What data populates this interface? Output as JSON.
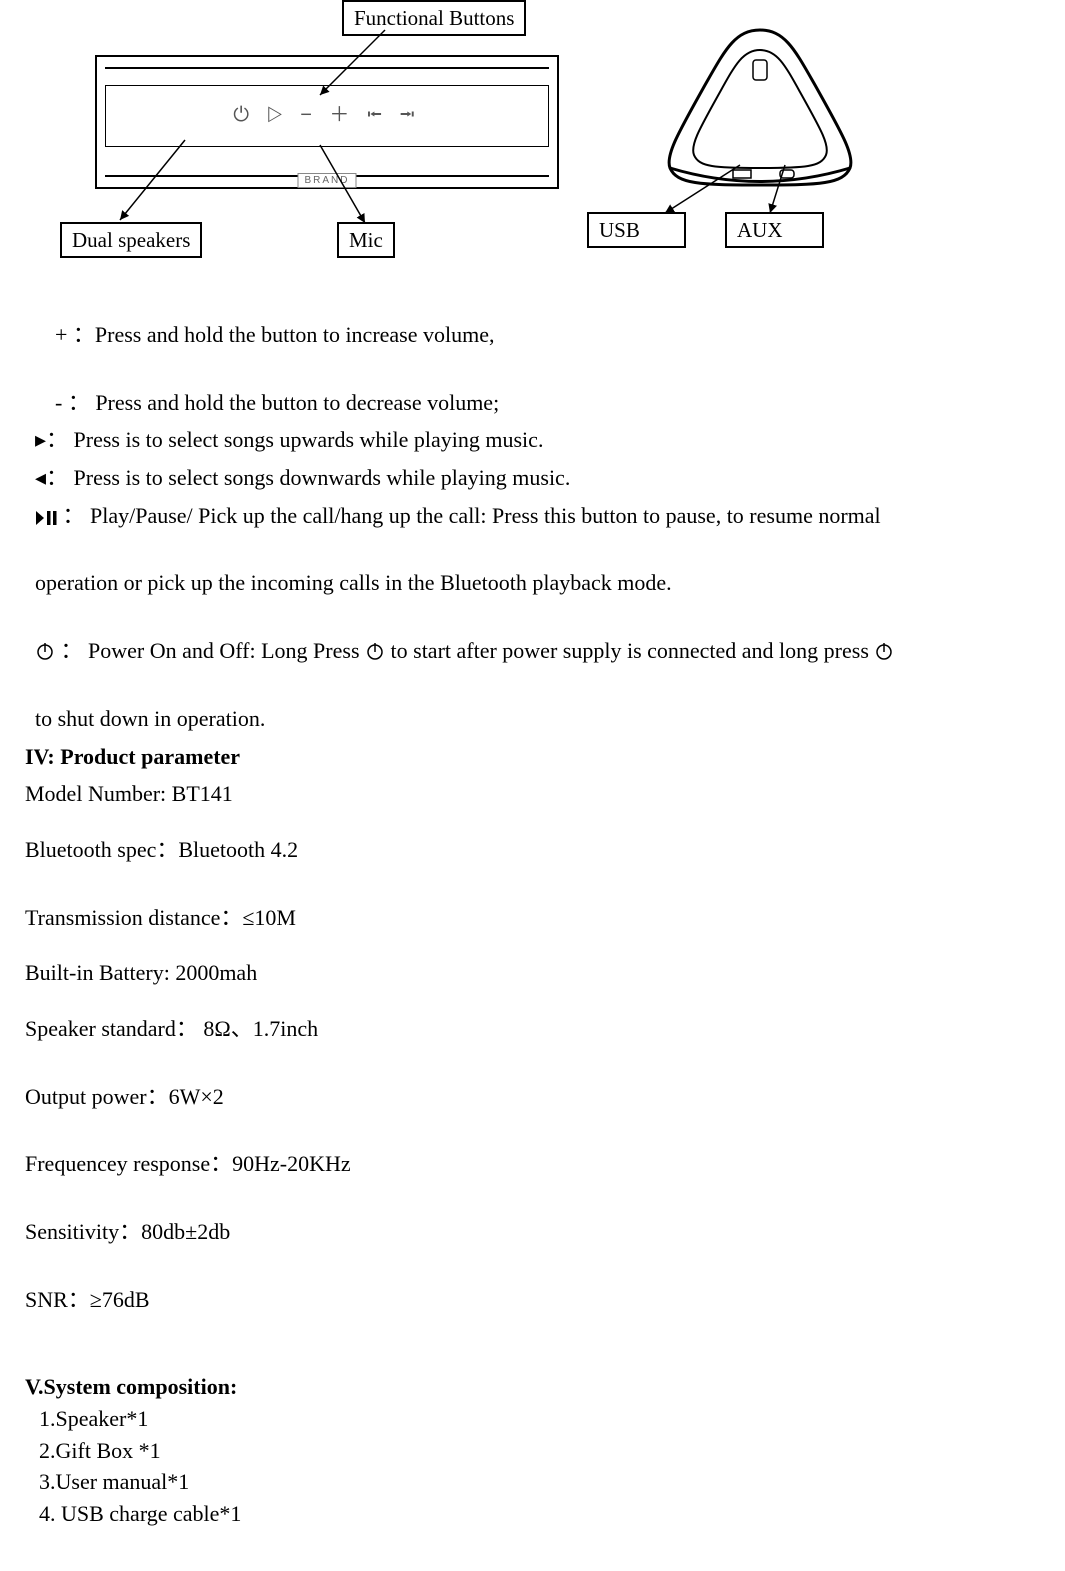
{
  "diagram": {
    "labels": {
      "functional_buttons": "Functional Buttons",
      "dual_speakers": "Dual speakers",
      "mic": "Mic",
      "usb": "USB",
      "aux": "AUX"
    },
    "brand_tag": "BRAND"
  },
  "controls": {
    "plus": "+   ：Press and hold the button to increase volume,",
    "minus": "-    ：  Press and hold the button to decrease volume;",
    "fwd": "▸： Press is to select songs upwards while playing music.",
    "back": "◂： Press is to select songs downwards while playing music.",
    "play_pause_1": " ： Play/Pause/ Pick up the call/hang up the call: Press this button to pause, to resume normal",
    "play_pause_2": "operation or pick up the incoming calls in the Bluetooth playback mode.",
    "power_prefix": "：  Power On and Off:   Long Press ",
    "power_mid": " to start after power supply is connected and long press ",
    "power_tail": "to shut down in operation."
  },
  "section_iv_title": "IV: Product parameter",
  "params": {
    "model": "Model Number: BT141",
    "bt_spec": "Bluetooth spec：Bluetooth 4.2",
    "distance": "Transmission distance：≤10M",
    "battery": "Built-in Battery: 2000mah",
    "speaker_std": "Speaker standard： 8Ω、1.7inch",
    "output": "Output power：6W×2",
    "freq": "Frequencey response：90Hz-20KHz",
    "sensitivity": "Sensitivity：80db±2db",
    "snr": "SNR：≥76dB"
  },
  "section_v_title": "V.System composition:",
  "composition": [
    "1.Speaker*1",
    "2.Gift Box *1",
    "3.User manual*1",
    "4. USB charge cable*1"
  ]
}
